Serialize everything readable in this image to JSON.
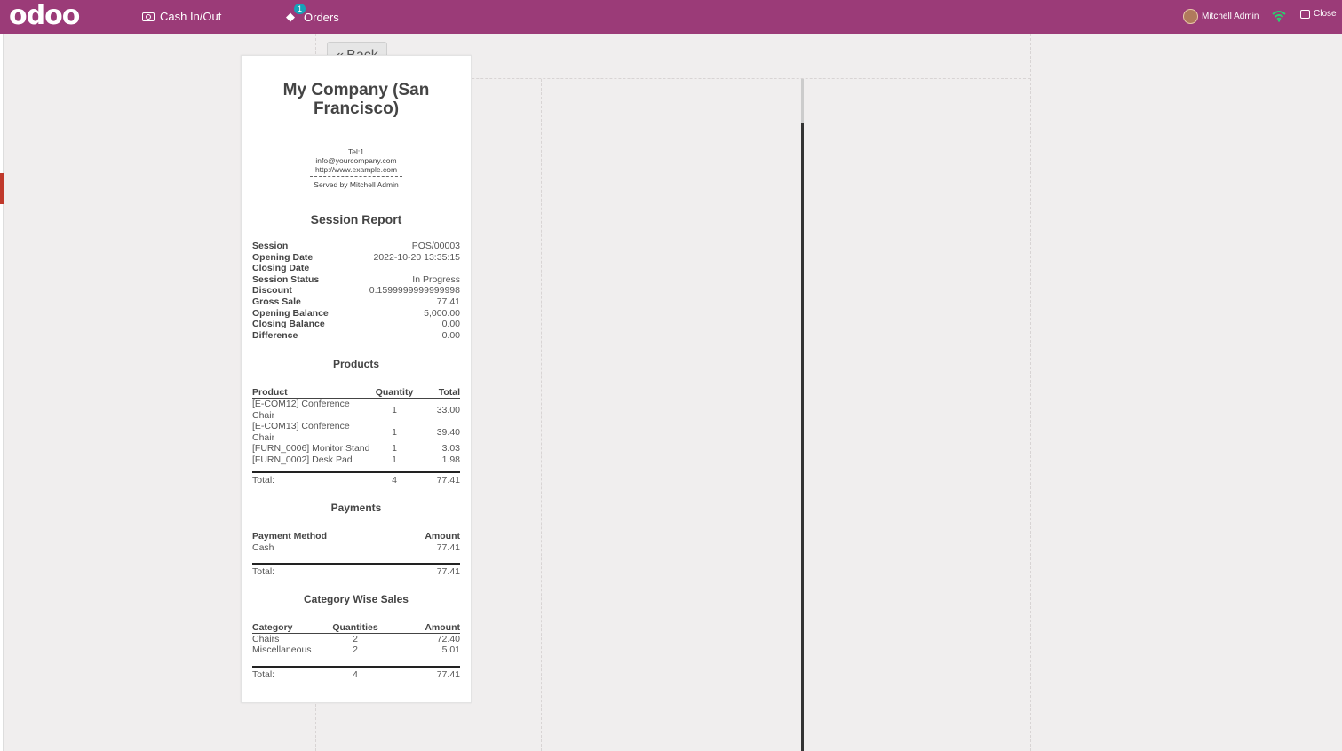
{
  "navbar": {
    "logo": "odoo",
    "cash_label": "Cash In/Out",
    "orders_label": "Orders",
    "orders_badge": "1",
    "user_name": "Mitchell Admin",
    "close_label": "Close",
    "bg_color": "#9b3b78"
  },
  "back_label": "Back",
  "receipt": {
    "company": "My Company (San Francisco)",
    "tel": "Tel:1",
    "email": "info@yourcompany.com",
    "website": "http://www.example.com",
    "served_by": "Served by Mitchell Admin",
    "report_title": "Session Report",
    "summary": [
      {
        "key": "Session",
        "value": "POS/00003"
      },
      {
        "key": "Opening Date",
        "value": "2022-10-20 13:35:15"
      },
      {
        "key": "Closing Date",
        "value": ""
      },
      {
        "key": "Session Status",
        "value": "In Progress"
      },
      {
        "key": "Discount",
        "value": "0.1599999999999998"
      },
      {
        "key": "Gross Sale",
        "value": "77.41"
      },
      {
        "key": "Opening Balance",
        "value": "5,000.00"
      },
      {
        "key": "Closing Balance",
        "value": "0.00"
      },
      {
        "key": "Difference",
        "value": "0.00"
      }
    ],
    "products": {
      "title": "Products",
      "headers": [
        "Product",
        "Quantity",
        "Total"
      ],
      "rows": [
        {
          "name": "[E-COM12] Conference Chair",
          "qty": "1",
          "total": "33.00"
        },
        {
          "name": "[E-COM13] Conference Chair",
          "qty": "1",
          "total": "39.40"
        },
        {
          "name": "[FURN_0006] Monitor Stand",
          "qty": "1",
          "total": "3.03"
        },
        {
          "name": "[FURN_0002] Desk Pad",
          "qty": "1",
          "total": "1.98"
        }
      ],
      "total_label": "Total:",
      "total_qty": "4",
      "total_amount": "77.41"
    },
    "payments": {
      "title": "Payments",
      "headers": [
        "Payment Method",
        "Amount"
      ],
      "rows": [
        {
          "method": "Cash",
          "amount": "77.41"
        }
      ],
      "total_label": "Total:",
      "total_amount": "77.41"
    },
    "categories": {
      "title": "Category Wise Sales",
      "headers": [
        "Category",
        "Quantities",
        "Amount"
      ],
      "rows": [
        {
          "name": "Chairs",
          "qty": "2",
          "amount": "72.40"
        },
        {
          "name": "Miscellaneous",
          "qty": "2",
          "amount": "5.01"
        }
      ],
      "total_label": "Total:",
      "total_qty": "4",
      "total_amount": "77.41"
    }
  }
}
